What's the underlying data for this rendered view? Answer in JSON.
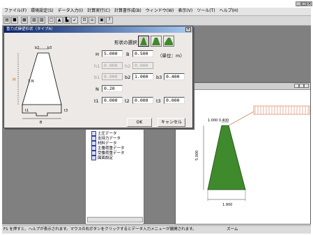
{
  "menu": [
    "ファイル(F)",
    "環境設定(S)",
    "データ入力(I)",
    "計算実行(C)",
    "計算書作成(B)",
    "ウィンドウ(W)",
    "表示(V)",
    "ツール(T)",
    "ヘルプ(H)"
  ],
  "dialog": {
    "title": "重力式擁壁形状（タイプA）",
    "shape_label": "形状の選択：",
    "unit_label": "（単位：m）",
    "fields": {
      "H": {
        "label": "H",
        "value": "5.000"
      },
      "B": {
        "label": "B",
        "value": "0.500"
      },
      "h1": {
        "label": "h1",
        "value": "0.000"
      },
      "h2": {
        "label": "h2",
        "value": "0.000"
      },
      "b1": {
        "label": "b1",
        "value": "0.000"
      },
      "b2": {
        "label": "b2",
        "value": "1.000"
      },
      "b3": {
        "label": "b3",
        "value": "0.400"
      },
      "N": {
        "label": "N",
        "value": "0.20"
      },
      "t1": {
        "label": "t1",
        "value": "0.000"
      },
      "t2": {
        "label": "t2",
        "value": "0.000"
      },
      "t3": {
        "label": "t3",
        "value": "0.000"
      }
    },
    "ok_label": "OK",
    "cancel_label": "キャンセル",
    "sketch_labels": {
      "b2": "b2",
      "b3": "b3",
      "h": "H",
      "ratio": "1:N",
      "t1": "t1",
      "t3": "t3",
      "b": "B"
    }
  },
  "tree": {
    "items": [
      "土圧データ",
      "支持力データ",
      "材料データ",
      "主働荷重データ",
      "受働荷重データ",
      "図面設定"
    ]
  },
  "drawing": {
    "top_dim": "1.000  0.400",
    "height_dim": "5.000",
    "base_dim": "1.900",
    "wall_color": "#3f8a2c",
    "load_color": "#e08060"
  },
  "status": {
    "help_text": "F1 を押すと、ヘルプが表示されます。マウスの右ボタンをクリックするとデータ入力メニューが展開されます。",
    "mode": "ズーム"
  }
}
